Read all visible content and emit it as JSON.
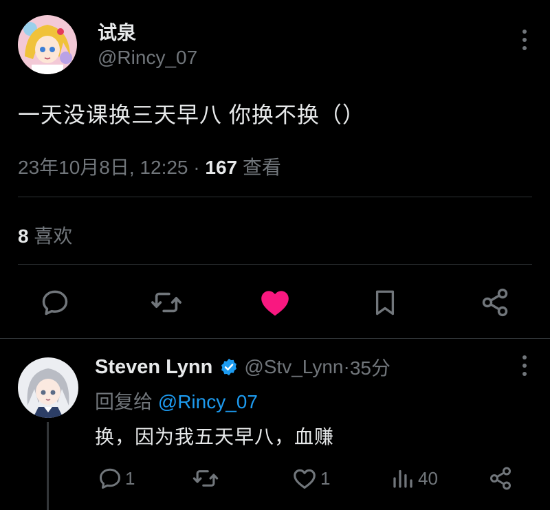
{
  "tweet": {
    "author_name": "试泉",
    "author_handle": "@Rincy_07",
    "text": "一天没课换三天早八 你换不换（）",
    "date": "23年10月8日, 12:25",
    "separator": " · ",
    "views": "167",
    "views_label": " 查看",
    "likes": "8",
    "likes_label": " 喜欢"
  },
  "actions": [
    {
      "name": "reply",
      "icon": "comment-icon"
    },
    {
      "name": "repost",
      "icon": "repost-icon"
    },
    {
      "name": "like",
      "icon": "heart-filled-icon",
      "color": "#f91880"
    },
    {
      "name": "bookmark",
      "icon": "bookmark-icon"
    },
    {
      "name": "share",
      "icon": "share-icon"
    }
  ],
  "reply": {
    "author_name": "Steven Lynn",
    "author_handle": "@Stv_Lynn",
    "separator": " · ",
    "time": "35分",
    "reply_to_label": "回复给 ",
    "reply_to_handle": "@Rincy_07",
    "text": "换，因为我五天早八，血赚",
    "replies": "1",
    "likes": "1",
    "views": "40"
  },
  "colors": {
    "background": "#000000",
    "text_primary": "#e7e9ea",
    "text_secondary": "#71767b",
    "accent": "#1d9bf0",
    "like": "#f91880",
    "divider": "#2f3336"
  }
}
